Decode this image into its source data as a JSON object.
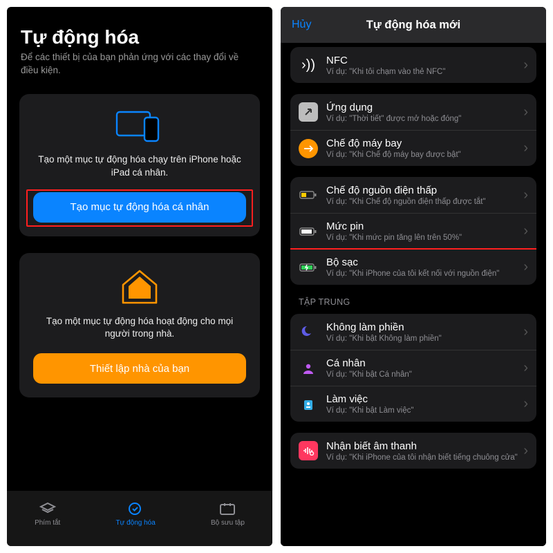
{
  "left": {
    "title": "Tự động hóa",
    "subtitle": "Để các thiết bị của bạn phản ứng với các thay đổi về điều kiện.",
    "personal": {
      "desc": "Tạo một mục tự động hóa chạy trên iPhone hoặc iPad cá nhân.",
      "button": "Tạo mục tự động hóa cá nhân"
    },
    "home": {
      "desc": "Tạo một mục tự động hóa hoạt động cho mọi người trong nhà.",
      "button": "Thiết lập nhà của bạn"
    },
    "tabs": {
      "shortcuts": "Phím tắt",
      "automation": "Tự động hóa",
      "gallery": "Bộ sưu tập"
    }
  },
  "right": {
    "cancel": "Hủy",
    "title": "Tự động hóa mới",
    "rows": {
      "nfc": {
        "label": "NFC",
        "example": "Ví dụ: \"Khi tôi chạm vào thẻ NFC\""
      },
      "app": {
        "label": "Ứng dụng",
        "example": "Ví dụ: \"Thời tiết\" được mở hoặc đóng\""
      },
      "airplane": {
        "label": "Chế độ máy bay",
        "example": "Ví dụ: \"Khi Chế độ máy bay được bật\""
      },
      "lowpower": {
        "label": "Chế độ nguồn điện thấp",
        "example": "Ví dụ: \"Khi Chế độ nguồn điện thấp được tắt\""
      },
      "battery": {
        "label": "Mức pin",
        "example": "Ví dụ: \"Khi mức pin tăng lên trên 50%\""
      },
      "charger": {
        "label": "Bộ sạc",
        "example": "Ví dụ: \"Khi iPhone của tôi kết nối với nguồn điện\""
      },
      "dnd": {
        "label": "Không làm phiền",
        "example": "Ví dụ: \"Khi bật Không làm phiền\""
      },
      "personal": {
        "label": "Cá nhân",
        "example": "Ví dụ: \"Khi bật Cá nhân\""
      },
      "work": {
        "label": "Làm việc",
        "example": "Ví dụ: \"Khi bật Làm việc\""
      },
      "sound": {
        "label": "Nhận biết âm thanh",
        "example": "Ví dụ: \"Khi iPhone của tôi nhận biết tiếng chuông cửa\""
      }
    },
    "sections": {
      "focus": "TẬP TRUNG"
    }
  }
}
